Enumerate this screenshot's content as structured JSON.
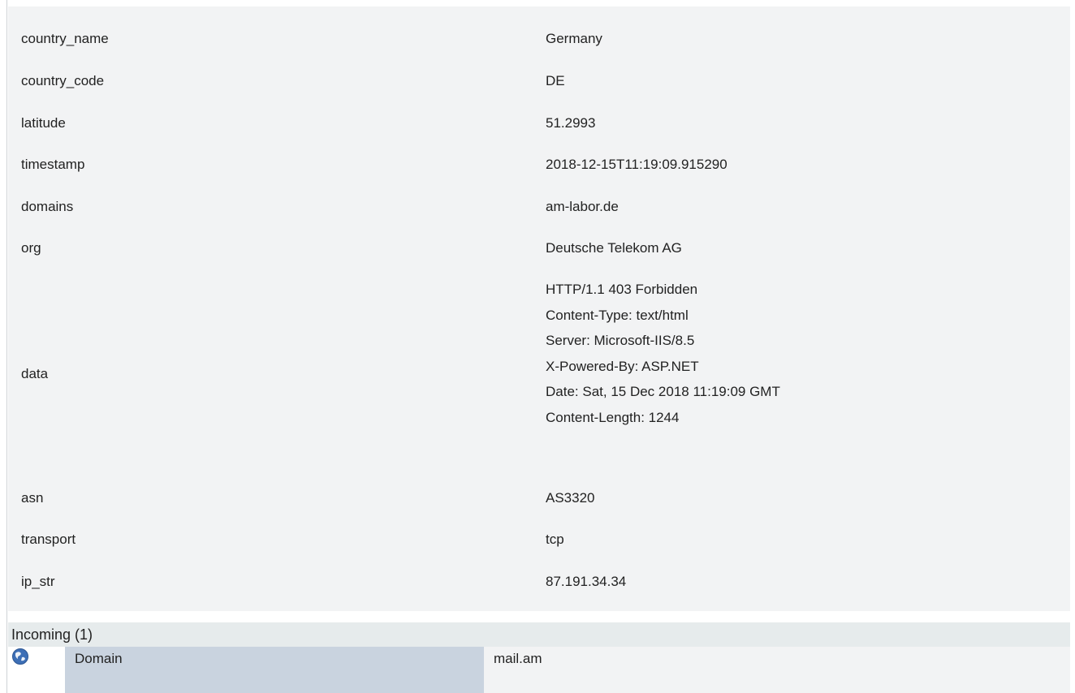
{
  "properties": [
    {
      "key": "country_name",
      "value": "Germany"
    },
    {
      "key": "country_code",
      "value": "DE"
    },
    {
      "key": "latitude",
      "value": "51.2993"
    },
    {
      "key": "timestamp",
      "value": "2018-12-15T11:19:09.915290"
    },
    {
      "key": "domains",
      "value": "am-labor.de"
    },
    {
      "key": "org",
      "value": "Deutsche Telekom AG"
    },
    {
      "key": "data",
      "value_lines": [
        "HTTP/1.1 403 Forbidden",
        "Content-Type: text/html",
        "Server: Microsoft-IIS/8.5",
        "X-Powered-By: ASP.NET",
        "Date: Sat, 15 Dec 2018 11:19:09 GMT",
        "Content-Length: 1244"
      ]
    },
    {
      "key": "asn",
      "value": "AS3320"
    },
    {
      "key": "transport",
      "value": "tcp"
    },
    {
      "key": "ip_str",
      "value": "87.191.34.34"
    }
  ],
  "incoming": {
    "title": "Incoming (1)",
    "items": [
      {
        "icon": "globe-icon",
        "type": "Domain",
        "value": "mail.am"
      }
    ]
  },
  "colors": {
    "panel_bg": "#f2f3f4",
    "header_bg": "#e6ebec",
    "type_cell_bg": "#c9d3df",
    "globe": "#3d6fb6"
  }
}
